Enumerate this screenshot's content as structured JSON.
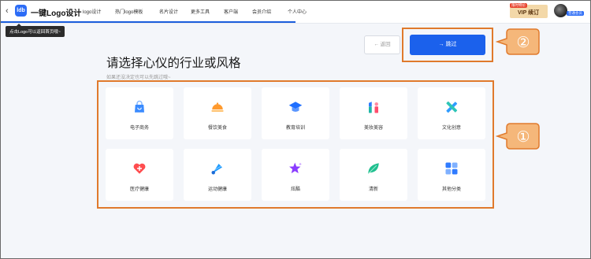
{
  "header": {
    "back_glyph": "‹",
    "logo_mark": "ldb",
    "brand": "一键Logo设计",
    "nav": [
      "logo设计",
      "热门logo模板",
      "名片设计",
      "更多工具",
      "客户端",
      "会员介绍",
      "个人中心"
    ],
    "vip_tag": "限时特价",
    "vip_label": "VIP 续订",
    "user_badge": "普通会员"
  },
  "tooltip": "点击Logo可以返回首页哦~",
  "controls": {
    "back_label": "← 返回",
    "skip_label": "→   跳过"
  },
  "main": {
    "heading": "请选择心仪的行业或风格",
    "subtext": "如果还没决定也可以先跳过哦~",
    "categories": [
      {
        "label": "电子商务",
        "icon": "shopping-bag-icon",
        "color": "#3a8bff"
      },
      {
        "label": "餐饮美食",
        "icon": "food-cloche-icon",
        "color": "#ff9a2e"
      },
      {
        "label": "教育培训",
        "icon": "graduation-cap-icon",
        "color": "#1f6fff"
      },
      {
        "label": "美妆美容",
        "icon": "lipstick-icon",
        "color": "#1fb7a6"
      },
      {
        "label": "文化创意",
        "icon": "pencil-ruler-icon",
        "color": "#2f9bff"
      },
      {
        "label": "医疗健康",
        "icon": "medical-heart-icon",
        "color": "#ff4d4f"
      },
      {
        "label": "运动健康",
        "icon": "shuttlecock-icon",
        "color": "#1f9bff"
      },
      {
        "label": "炫酷",
        "icon": "star-icon",
        "color": "#8a3cff"
      },
      {
        "label": "清新",
        "icon": "leaf-icon",
        "color": "#1fbf8f"
      },
      {
        "label": "其他分类",
        "icon": "grid-icon",
        "color": "#2f7bff"
      }
    ]
  },
  "annotations": {
    "marker_1": "①",
    "marker_2": "②",
    "accent": "#e07a2c",
    "fill": "#f5b77a"
  }
}
